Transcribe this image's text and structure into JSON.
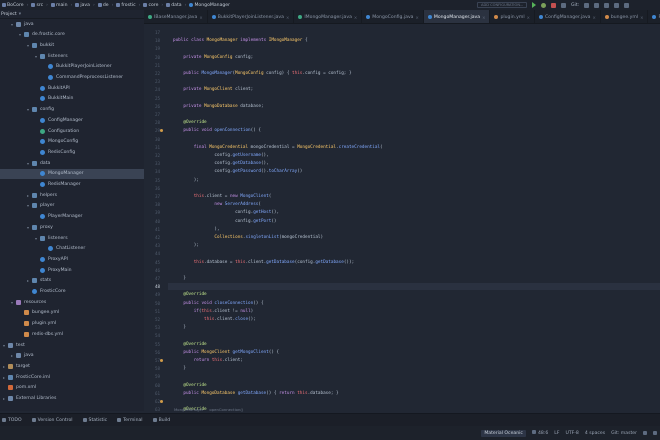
{
  "navbar": {
    "crumbs": [
      "BoCore",
      "src",
      "main",
      "java",
      "de",
      "frostic",
      "core",
      "data",
      "MongoManager"
    ],
    "run_config": "ADD CONFIGURATION...",
    "vcs_label": "Git:"
  },
  "project": {
    "header": "Project",
    "tree": [
      {
        "label": "java",
        "depth": 1,
        "icon": "folder",
        "open": true
      },
      {
        "label": "de.frostic.core",
        "depth": 2,
        "icon": "pkg",
        "open": true
      },
      {
        "label": "bukkit",
        "depth": 3,
        "icon": "pkg",
        "open": true
      },
      {
        "label": "listeners",
        "depth": 4,
        "icon": "pkg",
        "open": true
      },
      {
        "label": "BukkitPlayerJoinListener",
        "depth": 5,
        "icon": "cls"
      },
      {
        "label": "CommandPreprocessListener",
        "depth": 5,
        "icon": "cls"
      },
      {
        "label": "BukkitAPI",
        "depth": 4,
        "icon": "cls"
      },
      {
        "label": "BukkitMain",
        "depth": 4,
        "icon": "cls"
      },
      {
        "label": "config",
        "depth": 3,
        "icon": "pkg",
        "open": true
      },
      {
        "label": "ConfigManager",
        "depth": 4,
        "icon": "cls"
      },
      {
        "label": "Configuration",
        "depth": 4,
        "icon": "iface"
      },
      {
        "label": "MongoConfig",
        "depth": 4,
        "icon": "cls"
      },
      {
        "label": "RedisConfig",
        "depth": 4,
        "icon": "cls"
      },
      {
        "label": "data",
        "depth": 3,
        "icon": "pkg",
        "open": true
      },
      {
        "label": "MongoManager",
        "depth": 4,
        "icon": "cls",
        "selected": true
      },
      {
        "label": "RedisManager",
        "depth": 4,
        "icon": "cls"
      },
      {
        "label": "helpers",
        "depth": 3,
        "icon": "pkg"
      },
      {
        "label": "player",
        "depth": 3,
        "icon": "pkg",
        "open": true
      },
      {
        "label": "PlayerManager",
        "depth": 4,
        "icon": "cls"
      },
      {
        "label": "proxy",
        "depth": 3,
        "icon": "pkg",
        "open": true
      },
      {
        "label": "listeners",
        "depth": 4,
        "icon": "pkg",
        "open": true
      },
      {
        "label": "ChatListener",
        "depth": 5,
        "icon": "cls"
      },
      {
        "label": "ProxyAPI",
        "depth": 4,
        "icon": "cls"
      },
      {
        "label": "ProxyMain",
        "depth": 4,
        "icon": "cls"
      },
      {
        "label": "stats",
        "depth": 3,
        "icon": "pkg"
      },
      {
        "label": "FrosticCore",
        "depth": 3,
        "icon": "cls"
      },
      {
        "label": "resources",
        "depth": 1,
        "icon": "res",
        "open": true
      },
      {
        "label": "bungee.yml",
        "depth": 2,
        "icon": "yml"
      },
      {
        "label": "plugin.yml",
        "depth": 2,
        "icon": "yml"
      },
      {
        "label": "redis-dbs.yml",
        "depth": 2,
        "icon": "yml"
      },
      {
        "label": "test",
        "depth": 0,
        "icon": "folder",
        "open": true
      },
      {
        "label": "java",
        "depth": 1,
        "icon": "folder"
      },
      {
        "label": "target",
        "depth": 0,
        "icon": "tgt"
      },
      {
        "label": "FrosticCore.iml",
        "depth": 0,
        "icon": "pkg"
      },
      {
        "label": "pom.xml",
        "depth": 0,
        "icon": "xml"
      },
      {
        "label": "External Libraries",
        "depth": 0,
        "icon": "folder"
      }
    ]
  },
  "tabs": [
    {
      "label": "IBaseManager.java",
      "color": "#3ea883"
    },
    {
      "label": "BukkitPlayerJoinListener.java",
      "color": "#3f86d1"
    },
    {
      "label": "IMongoManager.java",
      "color": "#3ea883"
    },
    {
      "label": "MongoConfig.java",
      "color": "#3f86d1"
    },
    {
      "label": "MongoManager.java",
      "color": "#3f86d1",
      "active": true
    },
    {
      "label": "plugin.yml",
      "color": "#d08a4a"
    },
    {
      "label": "ConfigManager.java",
      "color": "#3f86d1"
    },
    {
      "label": "bungee.yml",
      "color": "#d08a4a"
    },
    {
      "label": "PlayerMain",
      "color": "#3f86d1"
    }
  ],
  "editor": {
    "first_line": 17,
    "current_line": 48,
    "gutter_marks": [
      29,
      57,
      62,
      67,
      72
    ],
    "lines": [
      [],
      [
        [
          "kw",
          "public "
        ],
        [
          "kw",
          "class "
        ],
        [
          "ty",
          "MongoManager "
        ],
        [
          "kw",
          "implements "
        ],
        [
          "ty",
          "IMongoManager "
        ],
        [
          "pl",
          "{"
        ]
      ],
      [],
      [
        [
          "pl",
          "    "
        ],
        [
          "kw",
          "private "
        ],
        [
          "ty",
          "MongoConfig "
        ],
        [
          "pl",
          "config;"
        ]
      ],
      [],
      [
        [
          "pl",
          "    "
        ],
        [
          "kw",
          "public "
        ],
        [
          "fn",
          "MongoManager"
        ],
        [
          "pl",
          "("
        ],
        [
          "ty",
          "MongoConfig "
        ],
        [
          "pl",
          "config) { "
        ],
        [
          "th",
          "this"
        ],
        [
          "pl",
          ".config = config; }"
        ]
      ],
      [],
      [
        [
          "pl",
          "    "
        ],
        [
          "kw",
          "private "
        ],
        [
          "ty",
          "MongoClient "
        ],
        [
          "pl",
          "client;"
        ]
      ],
      [],
      [
        [
          "pl",
          "    "
        ],
        [
          "kw",
          "private "
        ],
        [
          "ty",
          "MongoDatabase "
        ],
        [
          "pl",
          "database;"
        ]
      ],
      [],
      [
        [
          "pl",
          "    "
        ],
        [
          "an",
          "@Override"
        ]
      ],
      [
        [
          "pl",
          "    "
        ],
        [
          "kw",
          "public "
        ],
        [
          "kw",
          "void "
        ],
        [
          "fn",
          "openConnection"
        ],
        [
          "pl",
          "() {"
        ]
      ],
      [],
      [
        [
          "pl",
          "        "
        ],
        [
          "kw",
          "final "
        ],
        [
          "ty",
          "MongoCredential "
        ],
        [
          "pl",
          "mongoCredential = "
        ],
        [
          "ty",
          "MongoCredential"
        ],
        [
          "pl",
          "."
        ],
        [
          "fn",
          "createCredential"
        ],
        [
          "pl",
          "("
        ]
      ],
      [
        [
          "pl",
          "                config."
        ],
        [
          "fn",
          "getUsername"
        ],
        [
          "pl",
          "(),"
        ]
      ],
      [
        [
          "pl",
          "                config."
        ],
        [
          "fn",
          "getDatabase"
        ],
        [
          "pl",
          "(),"
        ]
      ],
      [
        [
          "pl",
          "                config."
        ],
        [
          "fn",
          "getPassword"
        ],
        [
          "pl",
          "()."
        ],
        [
          "fn",
          "toCharArray"
        ],
        [
          "pl",
          "()"
        ]
      ],
      [
        [
          "pl",
          "        );"
        ]
      ],
      [],
      [
        [
          "pl",
          "        "
        ],
        [
          "th",
          "this"
        ],
        [
          "pl",
          ".client = "
        ],
        [
          "kw",
          "new "
        ],
        [
          "fn",
          "MongoClient"
        ],
        [
          "pl",
          "("
        ]
      ],
      [
        [
          "pl",
          "                "
        ],
        [
          "kw",
          "new "
        ],
        [
          "fn",
          "ServerAddress"
        ],
        [
          "pl",
          "("
        ]
      ],
      [
        [
          "pl",
          "                        config."
        ],
        [
          "fn",
          "getHost"
        ],
        [
          "pl",
          "(),"
        ]
      ],
      [
        [
          "pl",
          "                        config."
        ],
        [
          "fn",
          "getPort"
        ],
        [
          "pl",
          "()"
        ]
      ],
      [
        [
          "pl",
          "                ),"
        ]
      ],
      [
        [
          "pl",
          "                "
        ],
        [
          "ty",
          "Collections"
        ],
        [
          "pl",
          "."
        ],
        [
          "fn",
          "singletonList"
        ],
        [
          "pl",
          "(mongoCredential)"
        ]
      ],
      [
        [
          "pl",
          "        );"
        ]
      ],
      [],
      [
        [
          "pl",
          "        "
        ],
        [
          "th",
          "this"
        ],
        [
          "pl",
          ".database = "
        ],
        [
          "th",
          "this"
        ],
        [
          "pl",
          ".client."
        ],
        [
          "fn",
          "getDatabase"
        ],
        [
          "pl",
          "(config."
        ],
        [
          "fn",
          "getDatabase"
        ],
        [
          "pl",
          "());"
        ]
      ],
      [],
      [
        [
          "pl",
          "    }"
        ]
      ],
      [],
      [
        [
          "pl",
          "    "
        ],
        [
          "an",
          "@Override"
        ]
      ],
      [
        [
          "pl",
          "    "
        ],
        [
          "kw",
          "public "
        ],
        [
          "kw",
          "void "
        ],
        [
          "fn",
          "closeConnection"
        ],
        [
          "pl",
          "() {"
        ]
      ],
      [
        [
          "pl",
          "        "
        ],
        [
          "kw",
          "if"
        ],
        [
          "pl",
          "("
        ],
        [
          "th",
          "this"
        ],
        [
          "pl",
          ".client != "
        ],
        [
          "kw",
          "null"
        ],
        [
          "pl",
          ")"
        ]
      ],
      [
        [
          "pl",
          "            "
        ],
        [
          "th",
          "this"
        ],
        [
          "pl",
          ".client."
        ],
        [
          "fn",
          "close"
        ],
        [
          "pl",
          "();"
        ]
      ],
      [
        [
          "pl",
          "    }"
        ]
      ],
      [],
      [
        [
          "pl",
          "    "
        ],
        [
          "an",
          "@Override"
        ]
      ],
      [
        [
          "pl",
          "    "
        ],
        [
          "kw",
          "public "
        ],
        [
          "ty",
          "MongoClient "
        ],
        [
          "fn",
          "getMongoClient"
        ],
        [
          "pl",
          "() {"
        ]
      ],
      [
        [
          "pl",
          "        "
        ],
        [
          "kw",
          "return "
        ],
        [
          "th",
          "this"
        ],
        [
          "pl",
          ".client;"
        ]
      ],
      [
        [
          "pl",
          "    }"
        ]
      ],
      [],
      [
        [
          "pl",
          "    "
        ],
        [
          "an",
          "@Override"
        ]
      ],
      [
        [
          "pl",
          "    "
        ],
        [
          "kw",
          "public "
        ],
        [
          "ty",
          "MongoDatabase "
        ],
        [
          "fn",
          "getDatabase"
        ],
        [
          "pl",
          "() { "
        ],
        [
          "kw",
          "return "
        ],
        [
          "th",
          "this"
        ],
        [
          "pl",
          ".database; }"
        ]
      ],
      [],
      [
        [
          "pl",
          "    "
        ],
        [
          "an",
          "@Override"
        ]
      ]
    ],
    "breadcrumb": [
      "MongoManager",
      "openConnection()"
    ]
  },
  "toolwindows": [
    "TODO",
    "Version Control",
    "Statistic",
    "Terminal",
    "Build"
  ],
  "status": {
    "message": "",
    "theme": "Material Oceanic",
    "position": "48:6",
    "line_sep": "LF",
    "encoding": "UTF-8",
    "indent": "4 spaces",
    "branch": "Git: master"
  }
}
